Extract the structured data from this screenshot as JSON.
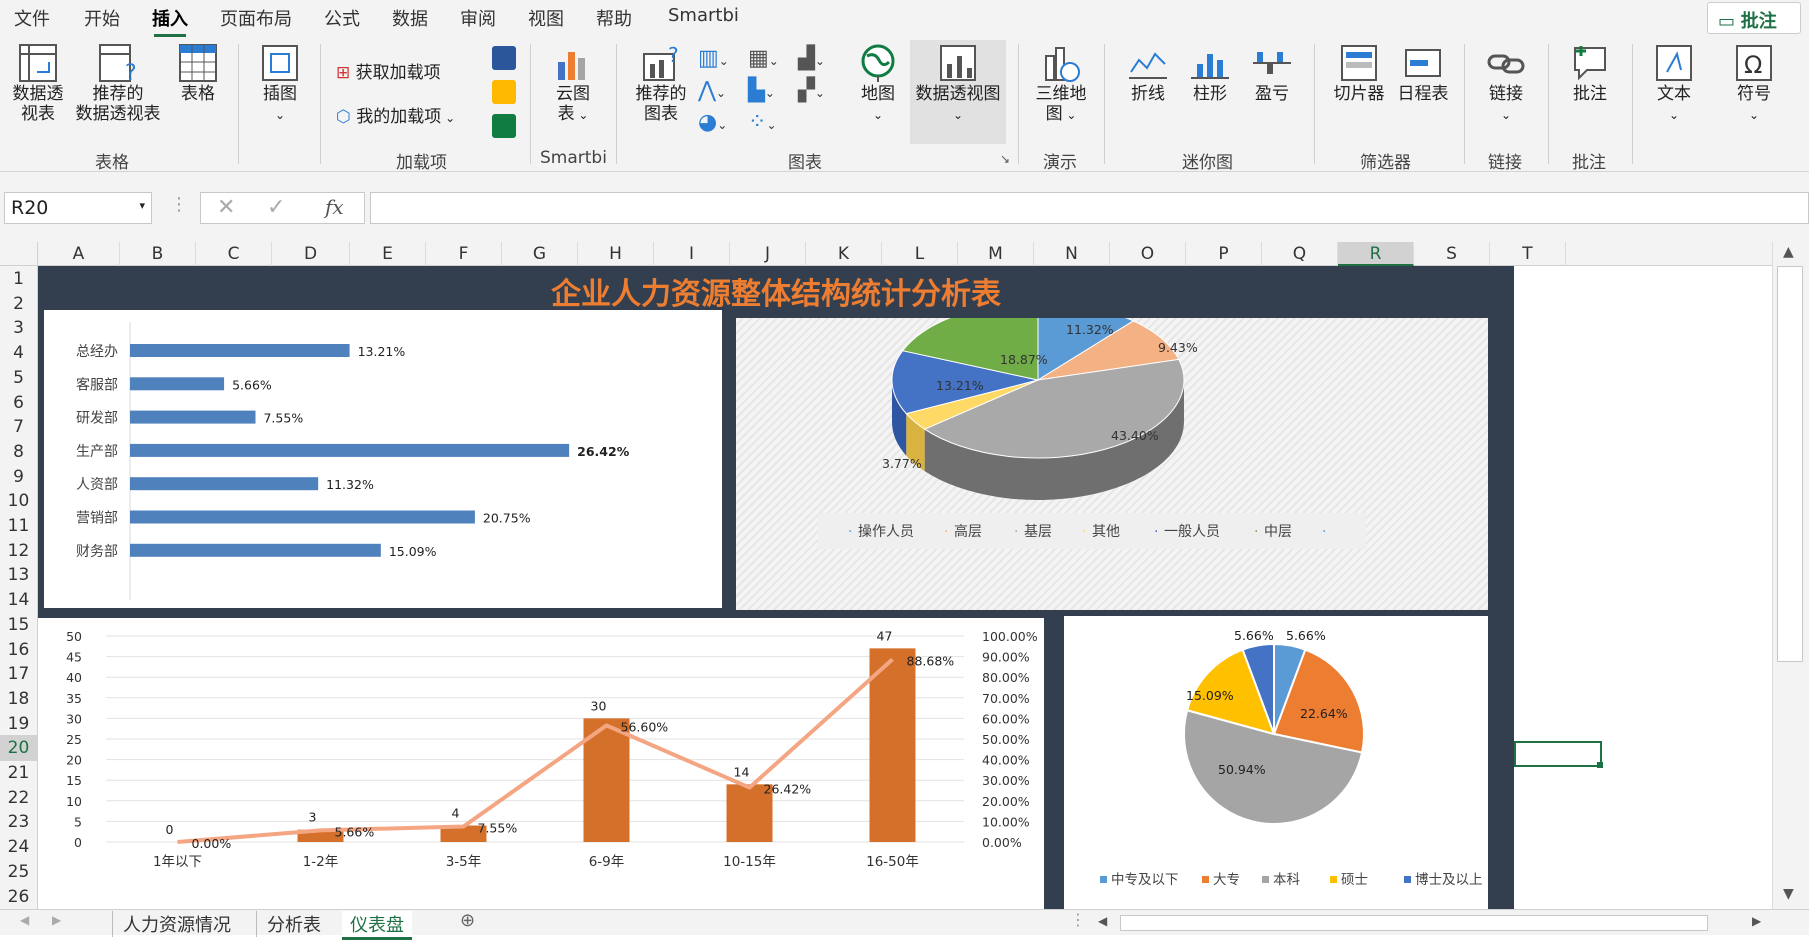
{
  "ribbon_tabs": [
    "文件",
    "开始",
    "插入",
    "页面布局",
    "公式",
    "数据",
    "审阅",
    "视图",
    "帮助",
    "Smartbi"
  ],
  "active_tab": "插入",
  "comment_button": "批注",
  "ribbon": {
    "pivot_table": "数据透\n视表",
    "recommended_pivot": "推荐的\n数据透视表",
    "table": "表格",
    "group_tables": "表格",
    "illustrations": "插图",
    "get_addins": "获取加载项",
    "my_addins": "我的加载项",
    "group_addins": "加载项",
    "cloud_chart": "云图\n表",
    "group_smartbi": "Smartbi",
    "recommended_charts": "推荐的\n图表",
    "maps": "地图",
    "pivot_chart": "数据透视图",
    "group_charts": "图表",
    "map_3d": "三维地\n图",
    "group_tours": "演示",
    "line": "折线",
    "column": "柱形",
    "win_loss": "盈亏",
    "group_sparklines": "迷你图",
    "slicer": "切片器",
    "timeline": "日程表",
    "group_filters": "筛选器",
    "link": "链接",
    "group_links": "链接",
    "comment": "批注",
    "group_comments": "批注",
    "text": "文本",
    "symbol": "符号"
  },
  "formula_bar": {
    "name_box": "R20",
    "fx": "fx",
    "formula": ""
  },
  "columns": [
    "A",
    "B",
    "C",
    "D",
    "E",
    "F",
    "G",
    "H",
    "I",
    "J",
    "K",
    "L",
    "M",
    "N",
    "O",
    "P",
    "Q",
    "R",
    "S",
    "T"
  ],
  "selected_column": "R",
  "rows": [
    "1",
    "2",
    "3",
    "4",
    "5",
    "6",
    "7",
    "8",
    "9",
    "10",
    "11",
    "12",
    "13",
    "14",
    "15",
    "16",
    "17",
    "18",
    "19",
    "20",
    "21",
    "22",
    "23",
    "24",
    "25",
    "26"
  ],
  "selected_row": "20",
  "dashboard_title": "企业人力资源整体结构统计分析表",
  "colors": {
    "title": "#ed7d31",
    "dash_bg": "#333f4f",
    "bar_blue": "#4f81bd",
    "bar_orange": "#d4702a",
    "line_salmon": "#f4a582",
    "excel_green": "#1e7145"
  },
  "chart_data": [
    {
      "type": "bar",
      "orientation": "horizontal",
      "categories": [
        "总经办",
        "客服部",
        "研发部",
        "生产部",
        "人资部",
        "营销部",
        "财务部"
      ],
      "values": [
        13.21,
        5.66,
        7.55,
        26.42,
        11.32,
        20.75,
        15.09
      ],
      "labels": [
        "13.21%",
        "5.66%",
        "7.55%",
        "26.42%",
        "11.32%",
        "20.75%",
        "15.09%"
      ],
      "xlim": [
        0,
        27
      ]
    },
    {
      "type": "pie",
      "style": "3d",
      "categories": [
        "操作人员",
        "高层",
        "基层",
        "其他",
        "一般人员",
        "中层"
      ],
      "values": [
        11.32,
        9.43,
        43.4,
        3.77,
        13.21,
        18.87
      ],
      "labels": [
        "11.32%",
        "9.43%",
        "43.40%",
        "3.77%",
        "13.21%",
        "18.87%"
      ],
      "legend": [
        "操作人员",
        "高层",
        "基层",
        "其他",
        "一般人员",
        "中层",
        ""
      ],
      "legend_position": "bottom"
    },
    {
      "type": "bar",
      "combo_with": "line",
      "categories": [
        "1年以下",
        "1-2年",
        "3-5年",
        "6-9年",
        "10-15年",
        "16-50年"
      ],
      "series": [
        {
          "axis": "left",
          "type": "bar",
          "values": [
            0,
            3,
            4,
            30,
            14,
            47
          ]
        },
        {
          "axis": "right",
          "type": "line",
          "values": [
            0.0,
            5.66,
            7.55,
            56.6,
            26.42,
            88.68
          ],
          "labels": [
            "0.00%",
            "5.66%",
            "7.55%",
            "56.60%",
            "26.42%",
            "88.68%"
          ]
        }
      ],
      "ylim": [
        0,
        50
      ],
      "yticks": [
        "0",
        "5",
        "10",
        "15",
        "20",
        "25",
        "30",
        "35",
        "40",
        "45",
        "50"
      ],
      "y2lim": [
        0,
        100
      ],
      "y2ticks": [
        "0.00%",
        "10.00%",
        "20.00%",
        "30.00%",
        "40.00%",
        "50.00%",
        "60.00%",
        "70.00%",
        "80.00%",
        "90.00%",
        "100.00%"
      ],
      "grid": true
    },
    {
      "type": "pie",
      "categories": [
        "中专及以下",
        "大专",
        "本科",
        "硕士",
        "博士及以上"
      ],
      "values": [
        5.66,
        22.64,
        50.94,
        15.09,
        5.66
      ],
      "labels": [
        "5.66%",
        "22.64%",
        "50.94%",
        "15.09%",
        "5.66%"
      ],
      "colors": [
        "#5b9bd5",
        "#ed7d31",
        "#a5a5a5",
        "#ffc000",
        "#4472c4"
      ],
      "legend_position": "bottom"
    }
  ],
  "sheet_tabs": [
    "人力资源情况",
    "分析表",
    "仪表盘"
  ],
  "active_sheet": "仪表盘"
}
